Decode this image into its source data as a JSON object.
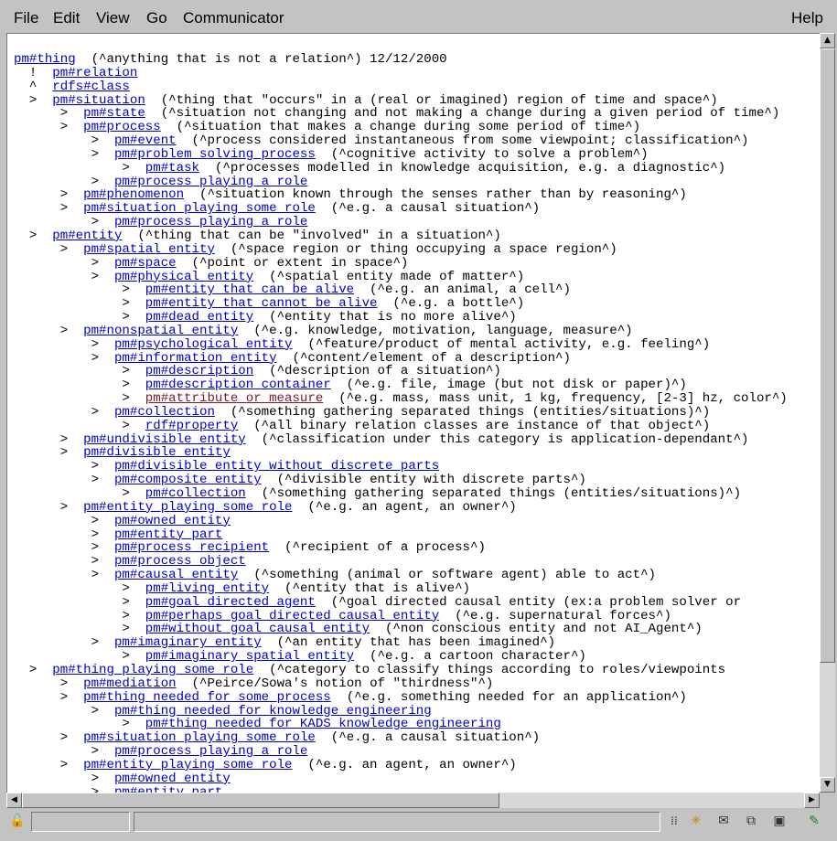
{
  "menubar": {
    "file": "File",
    "edit": "Edit",
    "view": "View",
    "go": "Go",
    "communicator": "Communicator",
    "help": "Help"
  },
  "lines": [
    {
      "pre": "",
      "link": "pm#thing",
      "post": "  (^anything that is not a relation^) 12/12/2000"
    },
    {
      "pre": "  !  ",
      "link": "pm#relation",
      "post": ""
    },
    {
      "pre": "  ^  ",
      "link": "rdfs#class",
      "post": ""
    },
    {
      "pre": "  >  ",
      "link": "pm#situation",
      "post": "  (^thing that \"occurs\" in a (real or imagined) region of time and space^)"
    },
    {
      "pre": "      >  ",
      "link": "pm#state",
      "post": "  (^situation not changing and not making a change during a given period of time^)"
    },
    {
      "pre": "      >  ",
      "link": "pm#process",
      "post": "  (^situation that makes a change during some period of time^)"
    },
    {
      "pre": "          >  ",
      "link": "pm#event",
      "post": "  (^process considered instantaneous from some viewpoint; classification^)"
    },
    {
      "pre": "          >  ",
      "link": "pm#problem_solving_process",
      "post": "  (^cognitive activity to solve a problem^)"
    },
    {
      "pre": "              >  ",
      "link": "pm#task",
      "post": "  (^processes modelled in knowledge acquisition, e.g. a diagnostic^)"
    },
    {
      "pre": "          >  ",
      "link": "pm#process_playing_a_role",
      "post": ""
    },
    {
      "pre": "      >  ",
      "link": "pm#phenomenon",
      "post": "  (^situation known through the senses rather than by reasoning^)"
    },
    {
      "pre": "      >  ",
      "link": "pm#situation_playing_some_role",
      "post": "  (^e.g. a causal situation^)"
    },
    {
      "pre": "          >  ",
      "link": "pm#process_playing_a_role",
      "post": ""
    },
    {
      "pre": "  >  ",
      "link": "pm#entity",
      "post": "  (^thing that can be \"involved\" in a situation^)"
    },
    {
      "pre": "      >  ",
      "link": "pm#spatial_entity",
      "post": "  (^space region or thing occupying a space region^)"
    },
    {
      "pre": "          >  ",
      "link": "pm#space",
      "post": "  (^point or extent in space^)"
    },
    {
      "pre": "          >  ",
      "link": "pm#physical_entity",
      "post": "  (^spatial entity made of matter^)"
    },
    {
      "pre": "              >  ",
      "link": "pm#entity_that_can_be_alive",
      "post": "  (^e.g. an animal, a cell^)"
    },
    {
      "pre": "              >  ",
      "link": "pm#entity_that_cannot_be_alive",
      "post": "  (^e.g. a bottle^)"
    },
    {
      "pre": "              >  ",
      "link": "pm#dead_entity",
      "post": "  (^entity that is no more alive^)"
    },
    {
      "pre": "      >  ",
      "link": "pm#nonspatial_entity",
      "post": "  (^e.g. knowledge, motivation, language, measure^)"
    },
    {
      "pre": "          >  ",
      "link": "pm#psychological_entity",
      "post": "  (^feature/product of mental activity, e.g. feeling^)"
    },
    {
      "pre": "          >  ",
      "link": "pm#information_entity",
      "post": "  (^content/element of a description^)"
    },
    {
      "pre": "              >  ",
      "link": "pm#description",
      "post": "  (^description of a situation^)"
    },
    {
      "pre": "              >  ",
      "link": "pm#description_container",
      "post": "  (^e.g. file, image (but not disk or paper)^)"
    },
    {
      "pre": "              >  ",
      "link": "pm#attribute_or_measure",
      "post": "  (^e.g. mass, mass unit, 1 kg, frequency, [2-3] hz, color^)",
      "visited": true
    },
    {
      "pre": "          >  ",
      "link": "pm#collection",
      "post": "  (^something gathering separated things (entities/situations)^)"
    },
    {
      "pre": "              >  ",
      "link": "rdf#property",
      "post": "  (^all binary relation classes are instance of that object^)"
    },
    {
      "pre": "      >  ",
      "link": "pm#undivisible_entity",
      "post": "  (^classification under this category is application-dependant^)"
    },
    {
      "pre": "      >  ",
      "link": "pm#divisible_entity",
      "post": ""
    },
    {
      "pre": "          >  ",
      "link": "pm#divisible_entity_without_discrete_parts",
      "post": ""
    },
    {
      "pre": "          >  ",
      "link": "pm#composite_entity",
      "post": "  (^divisible entity with discrete parts^)"
    },
    {
      "pre": "              >  ",
      "link": "pm#collection",
      "post": "  (^something gathering separated things (entities/situations)^)"
    },
    {
      "pre": "      >  ",
      "link": "pm#entity_playing_some_role",
      "post": "  (^e.g. an agent, an owner^)"
    },
    {
      "pre": "          >  ",
      "link": "pm#owned_entity",
      "post": ""
    },
    {
      "pre": "          >  ",
      "link": "pm#entity_part",
      "post": ""
    },
    {
      "pre": "          >  ",
      "link": "pm#process_recipient",
      "post": "  (^recipient of a process^)"
    },
    {
      "pre": "          >  ",
      "link": "pm#process_object",
      "post": ""
    },
    {
      "pre": "          >  ",
      "link": "pm#causal_entity",
      "post": "  (^something (animal or software agent) able to act^)"
    },
    {
      "pre": "              >  ",
      "link": "pm#living_entity",
      "post": "  (^entity that is alive^)"
    },
    {
      "pre": "              >  ",
      "link": "pm#goal_directed_agent",
      "post": "  (^goal directed causal entity (ex:a problem solver or"
    },
    {
      "pre": "              >  ",
      "link": "pm#perhaps_goal_directed_causal_entity",
      "post": "  (^e.g. supernatural forces^)"
    },
    {
      "pre": "              >  ",
      "link": "pm#without_goal_causal_entity",
      "post": "  (^non conscious entity and not AI_Agent^)"
    },
    {
      "pre": "          >  ",
      "link": "pm#imaginary_entity",
      "post": "  (^an entity that has been imagined^)"
    },
    {
      "pre": "              >  ",
      "link": "pm#imaginary_spatial_entity",
      "post": "  (^e.g. a cartoon character^)"
    },
    {
      "pre": "  >  ",
      "link": "pm#thing_playing_some_role",
      "post": "  (^category to classify things according to roles/viewpoints"
    },
    {
      "pre": "      >  ",
      "link": "pm#mediation",
      "post": "  (^Peirce/Sowa's notion of \"thirdness\"^)"
    },
    {
      "pre": "      >  ",
      "link": "pm#thing_needed_for_some_process",
      "post": "  (^e.g. something needed for an application^)"
    },
    {
      "pre": "          >  ",
      "link": "pm#thing_needed_for_knowledge_engineering",
      "post": ""
    },
    {
      "pre": "              >  ",
      "link": "pm#thing_needed_for_KADS_knowledge_engineering",
      "post": ""
    },
    {
      "pre": "      >  ",
      "link": "pm#situation_playing_some_role",
      "post": "  (^e.g. a causal situation^)"
    },
    {
      "pre": "          >  ",
      "link": "pm#process_playing_a_role",
      "post": ""
    },
    {
      "pre": "      >  ",
      "link": "pm#entity_playing_some_role",
      "post": "  (^e.g. an agent, an owner^)"
    },
    {
      "pre": "          >  ",
      "link": "pm#owned_entity",
      "post": ""
    },
    {
      "pre": "          >  ",
      "link": "pm#entity_part",
      "post": ""
    }
  ],
  "status": {
    "icons": [
      "lock-icon",
      "network-activity-icon",
      "navigator-icon",
      "mail-icon",
      "discussion-icon",
      "composer-icon",
      "edit-pencil-icon"
    ]
  }
}
